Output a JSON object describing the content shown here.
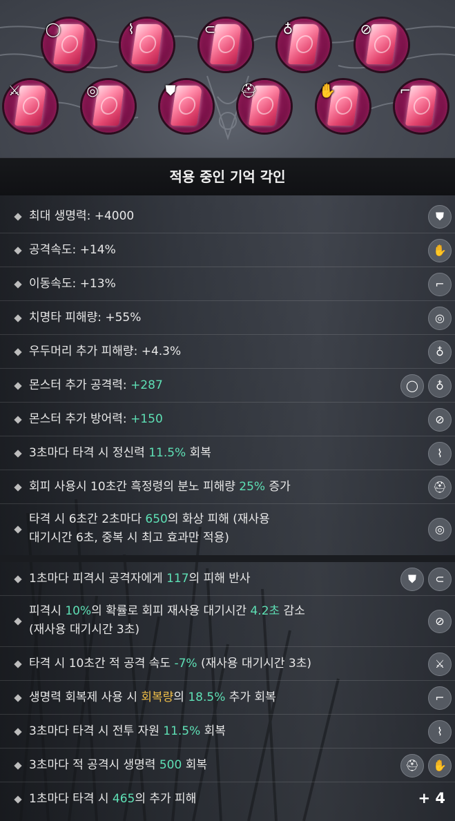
{
  "header": {
    "title": "적용 중인 기억 각인"
  },
  "slots": [
    {
      "icon": "ring-icon",
      "glyph": "◯"
    },
    {
      "icon": "necklace-icon",
      "glyph": "⌇"
    },
    {
      "icon": "belt-icon",
      "glyph": "⊂"
    },
    {
      "icon": "earring-icon",
      "glyph": "♁"
    },
    {
      "icon": "bracelet-icon",
      "glyph": "⊘"
    },
    {
      "icon": "sword-icon",
      "glyph": "⚔"
    },
    {
      "icon": "shield-icon",
      "glyph": "◎"
    },
    {
      "icon": "armor-icon",
      "glyph": "⛊"
    },
    {
      "icon": "helmet-icon",
      "glyph": "⛑"
    },
    {
      "icon": "glove-icon",
      "glyph": "✋"
    },
    {
      "icon": "boots-icon",
      "glyph": "⌐"
    }
  ],
  "stats": [
    {
      "name": "stat-max-hp",
      "text": "최대 생명력: +4000",
      "icons": [
        {
          "name": "armor-icon",
          "glyph": "⛊"
        }
      ]
    },
    {
      "name": "stat-attack-speed",
      "text": "공격속도: +14%",
      "icons": [
        {
          "name": "glove-icon",
          "glyph": "✋"
        }
      ]
    },
    {
      "name": "stat-move-speed",
      "text": "이동속도: +13%",
      "icons": [
        {
          "name": "boots-icon",
          "glyph": "⌐"
        }
      ]
    },
    {
      "name": "stat-crit-damage",
      "text": "치명타 피해량: +55%",
      "icons": [
        {
          "name": "shield-icon",
          "glyph": "◎"
        }
      ]
    },
    {
      "name": "stat-boss-damage",
      "text": "우두머리 추가 피해량: +4.3%",
      "icons": [
        {
          "name": "earring-icon",
          "glyph": "♁"
        }
      ]
    },
    {
      "name": "stat-monster-attack",
      "pre": "몬스터 추가 공격력: ",
      "hl": "+287",
      "post": "",
      "icons": [
        {
          "name": "ring-icon",
          "glyph": "◯"
        },
        {
          "name": "earring-icon",
          "glyph": "♁"
        }
      ]
    },
    {
      "name": "stat-monster-defense",
      "pre": "몬스터 추가 방어력: ",
      "hl": "+150",
      "post": "",
      "icons": [
        {
          "name": "bracelet-icon",
          "glyph": "⊘"
        }
      ]
    },
    {
      "name": "stat-mp-recovery",
      "pre": "3초마다 타격 시 정신력 ",
      "hl": "11.5%",
      "post": " 회복",
      "icons": [
        {
          "name": "necklace-icon",
          "glyph": "⌇"
        }
      ]
    },
    {
      "name": "stat-dodge-rage",
      "pre": "회피 사용시 10초간 흑정령의 분노 피해량 ",
      "hl": "25%",
      "post": " 증가",
      "icons": [
        {
          "name": "helmet-icon",
          "glyph": "⛑"
        }
      ]
    }
  ],
  "burn": {
    "line1_pre": "타격 시 6초간 2초마다 ",
    "line1_hl": "650",
    "line1_post": "의 화상 피해 (재사용",
    "line2": "대기시간 6초, 중복 시 최고 효과만 적용)",
    "icon": {
      "name": "shield-icon",
      "glyph": "◎"
    }
  },
  "effects": {
    "reflect": {
      "pre": "1초마다 피격시 공격자에게 ",
      "hl": "117",
      "post": "의 피해 반사"
    },
    "cooldown": {
      "l1a": "피격시 ",
      "l1b": "10%",
      "l1c": "의 확률로 회피 재사용 대기시간 ",
      "l1d": "4.2초",
      "l1e": " 감소",
      "line2": "(재사용 대기시간 3초)"
    },
    "slow": {
      "pre": "타격 시 10초간 적 공격 속도 ",
      "hl": "-7%",
      "post": " (재사용 대기시간 3초)"
    },
    "potion": {
      "a": "생명력 회복제 사용 시 ",
      "b": "회복량",
      "c": "의 ",
      "d": "18.5%",
      "e": " 추가 회복"
    },
    "resource": {
      "pre": "3초마다 타격 시 전투 자원 ",
      "hl": "11.5%",
      "post": " 회복"
    },
    "hp_regen": {
      "pre": "3초마다 적 공격시 생명력 ",
      "hl": "500",
      "post": " 회복"
    },
    "extra_damage": {
      "pre": "1초마다 타격 시 ",
      "hl": "465",
      "post": "의 추가 피해"
    },
    "more_count": "+ 4"
  }
}
